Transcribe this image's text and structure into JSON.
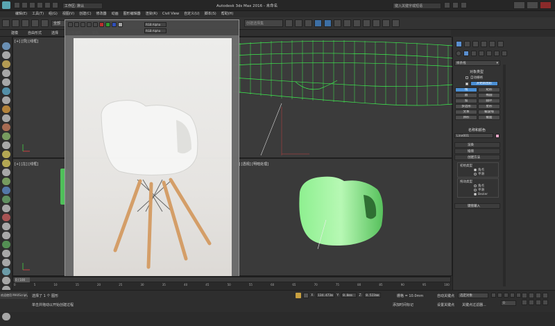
{
  "app": {
    "title": "Autodesk 3ds Max 2016 - 未命名",
    "workspace_label": "工作区: 默认",
    "search_placeholder": "键入关键字或短语"
  },
  "menubar": {
    "items": [
      "编辑(E)",
      "工具(T)",
      "组(G)",
      "视图(V)",
      "创建(C)",
      "修改器",
      "动画",
      "图形编辑器",
      "渲染(R)",
      "Civil View",
      "自定义(U)",
      "脚本(S)",
      "帮助(H)"
    ]
  },
  "toolbar": {
    "selection_filter": "全部",
    "named_selection": "创建选择集",
    "viewport_select": "视图"
  },
  "ribbon": {
    "tabs": [
      "建模",
      "自由形式",
      "选择",
      "对象绘制",
      "填充"
    ]
  },
  "viewports": {
    "top_left": "[+] [顶] [线框]",
    "bottom_left": "[+] [左] [线框]",
    "bottom_right": "[+] [透视] [明暗处理]"
  },
  "reference_image": {
    "toolbar_label": "RGB Alpha",
    "channel_label": "RGB Alpha"
  },
  "command_panel": {
    "category_dropdown": "样条线",
    "rollout_object_type": "对象类型",
    "auto_grid": "自动栅格",
    "start_new_shape": "开始新图形",
    "buttons": [
      [
        "线",
        "矩形"
      ],
      [
        "圆",
        "椭圆"
      ],
      [
        "弧",
        "圆环"
      ],
      [
        "多边形",
        "星形"
      ],
      [
        "文本",
        "螺旋线"
      ],
      [
        "卵形",
        "截面"
      ]
    ],
    "rollout_name_color": "名称和颜色",
    "object_name": "Line001",
    "rollout_render": "渲染",
    "rollout_interpolation": "插值",
    "rollout_creation_method": "创建方法",
    "initial_type_label": "初始类型",
    "initial_options": [
      "角点",
      "平滑"
    ],
    "drag_type_label": "拖动类型",
    "drag_options": [
      "角点",
      "平滑",
      "Bezier"
    ],
    "rollout_keyboard": "键盘输入",
    "accent_color": "#4b8fd4",
    "swatch_color": "#e7a6c6"
  },
  "timeline": {
    "frame_label": "0 / 100",
    "ticks": [
      "0",
      "5",
      "10",
      "15",
      "20",
      "25",
      "30",
      "35",
      "40",
      "45",
      "50",
      "55",
      "60",
      "65",
      "70",
      "75",
      "80",
      "85",
      "90",
      "95",
      "100"
    ]
  },
  "status": {
    "line1": "选择了 1 个 图形",
    "line2": "单击并拖动以开始创建过程",
    "welcome": "欢迎使用 MAXScript。",
    "x_label": "X:",
    "x_value": "134.473m",
    "y_label": "Y:",
    "y_value": "0.0mm",
    "z_label": "Z:",
    "z_value": "0.523mm",
    "grid_label": "栅格 = 10.0mm",
    "auto_key": "自动关键点",
    "set_key": "设置关键点",
    "selected": "选定对象",
    "key_filters": "关键点过滤器...",
    "add_time_tag": "添加时间标记",
    "frame_value": "0"
  }
}
